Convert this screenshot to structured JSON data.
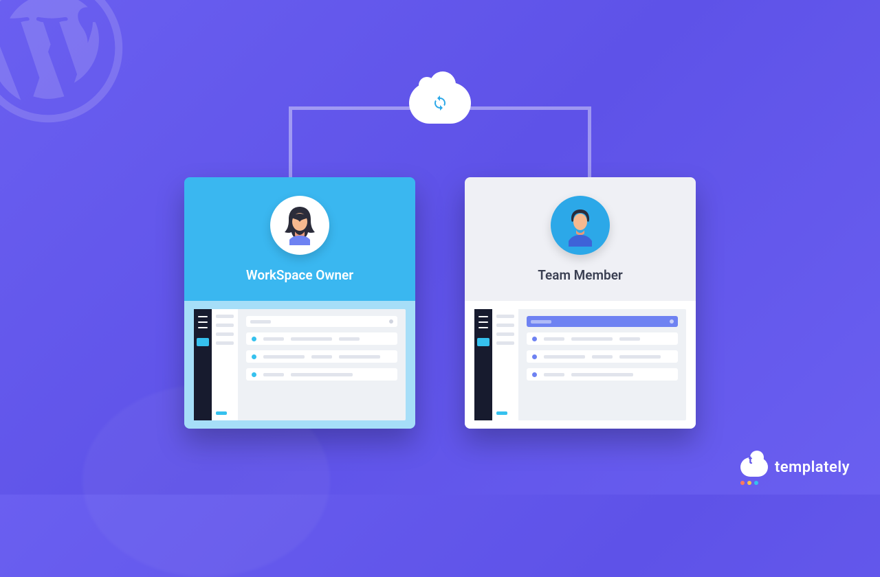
{
  "roles": {
    "owner": {
      "label": "WorkSpace Owner"
    },
    "member": {
      "label": "Team Member"
    }
  },
  "brand": {
    "name": "templately"
  },
  "icons": {
    "cloud_sync": "cloud-sync-icon",
    "wp_watermark": "wordpress-icon"
  }
}
